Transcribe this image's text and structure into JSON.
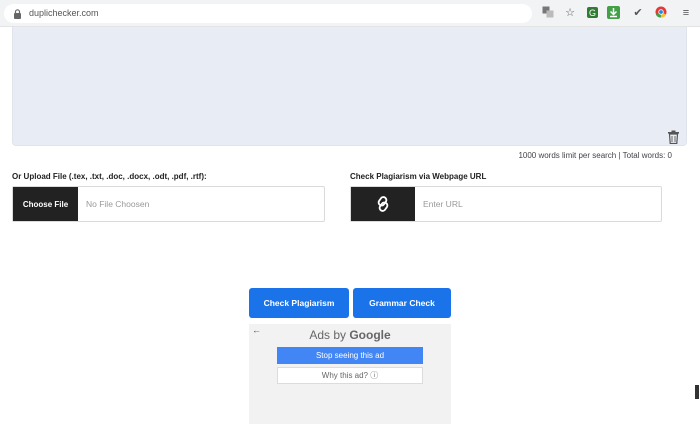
{
  "browser": {
    "url": "duplichecker.com"
  },
  "editor": {
    "word_limit_text": "1000 words limit per search | Total words: 0"
  },
  "upload": {
    "label": "Or Upload File (.tex, .txt, .doc, .docx, .odt, .pdf, .rtf):",
    "button_label": "Choose File",
    "status_text": "No File Choosen"
  },
  "url_check": {
    "label": "Check Plagiarism via Webpage URL",
    "placeholder": "Enter URL"
  },
  "actions": {
    "check_plagiarism_label": "Check Plagiarism",
    "grammar_check_label": "Grammar Check"
  },
  "ad": {
    "ads_by_prefix": "Ads by",
    "ads_by_brand": "Google",
    "stop_label": "Stop seeing this ad",
    "why_label": "Why this ad? ⓘ"
  },
  "colors": {
    "primary_blue": "#1a73e8",
    "ad_blue": "#4285f4",
    "dark_button": "#222222",
    "editor_bg": "#e8ecf5"
  },
  "icons": [
    "lock-icon",
    "translate-icon",
    "star-icon",
    "extension-icon",
    "download-icon",
    "check-icon",
    "chrome-icon",
    "menu-icon",
    "trash-icon",
    "link-icon",
    "back-arrow-icon"
  ]
}
